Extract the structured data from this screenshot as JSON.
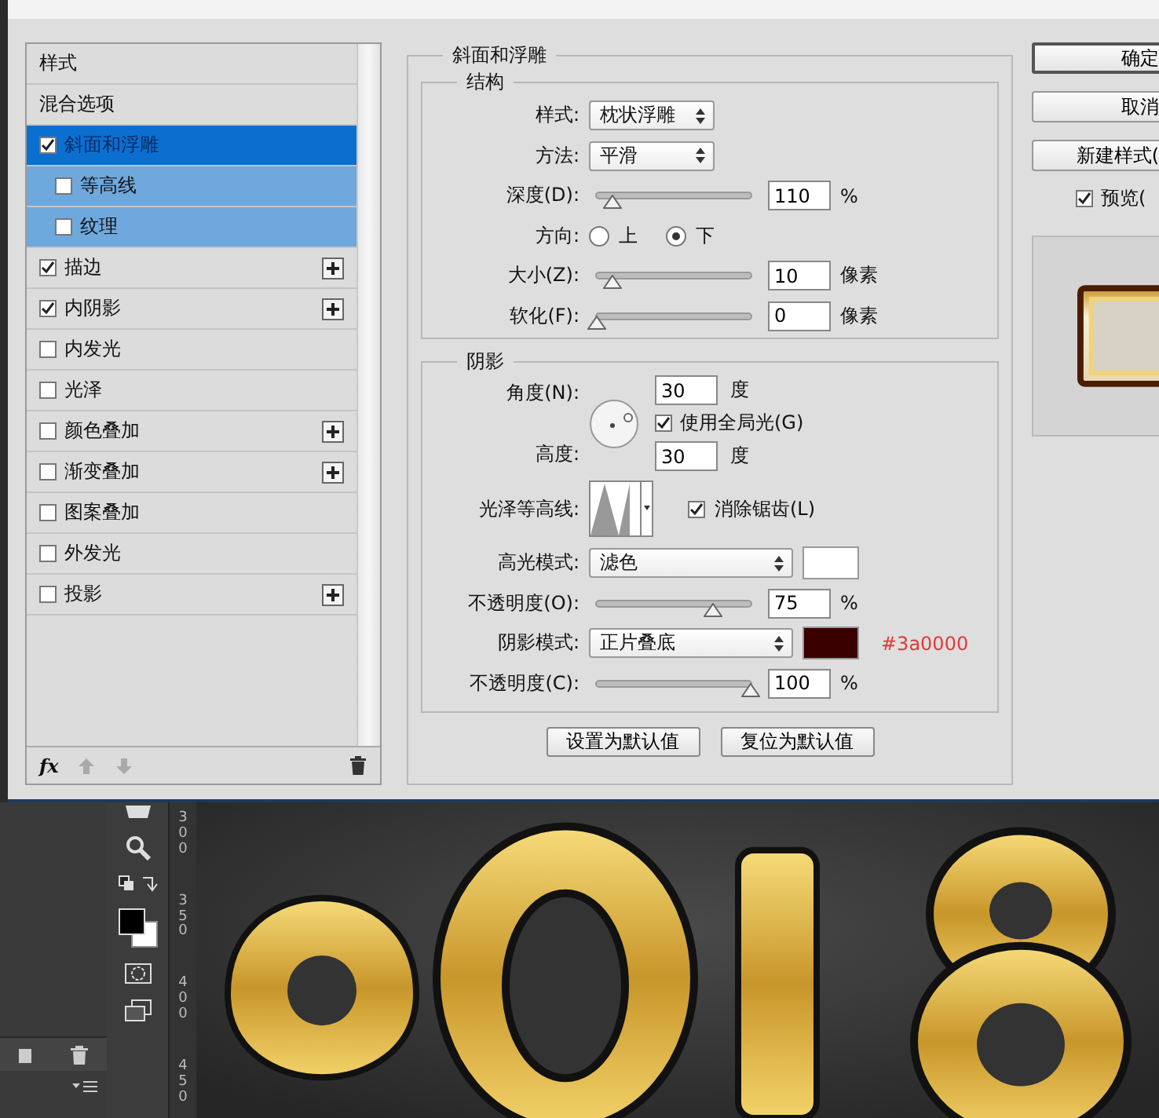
{
  "styles_list": {
    "items": [
      {
        "kind": "heading",
        "label": "样式"
      },
      {
        "kind": "heading",
        "label": "混合选项"
      },
      {
        "kind": "effect",
        "label": "斜面和浮雕",
        "checked": true,
        "selected": true,
        "children": [
          {
            "label": "等高线",
            "checked": false,
            "selected": false
          },
          {
            "label": "纹理",
            "checked": false,
            "selected": false
          }
        ]
      },
      {
        "kind": "effect",
        "label": "描边",
        "checked": true,
        "selected": false,
        "addable": true
      },
      {
        "kind": "effect",
        "label": "内阴影",
        "checked": true,
        "selected": false,
        "addable": true
      },
      {
        "kind": "effect",
        "label": "内发光",
        "checked": false,
        "selected": false,
        "addable": false
      },
      {
        "kind": "effect",
        "label": "光泽",
        "checked": false,
        "selected": false,
        "addable": false
      },
      {
        "kind": "effect",
        "label": "颜色叠加",
        "checked": false,
        "selected": false,
        "addable": true
      },
      {
        "kind": "effect",
        "label": "渐变叠加",
        "checked": false,
        "selected": false,
        "addable": true
      },
      {
        "kind": "effect",
        "label": "图案叠加",
        "checked": false,
        "selected": false,
        "addable": false
      },
      {
        "kind": "effect",
        "label": "外发光",
        "checked": false,
        "selected": false,
        "addable": false
      },
      {
        "kind": "effect",
        "label": "投影",
        "checked": false,
        "selected": false,
        "addable": true
      }
    ],
    "footer_fx": "fx"
  },
  "bevel": {
    "title": "斜面和浮雕",
    "structure": {
      "title": "结构",
      "rows": [
        {
          "kind": "select",
          "label": "样式:",
          "value": "枕状浮雕"
        },
        {
          "kind": "select",
          "label": "方法:",
          "value": "平滑"
        },
        {
          "kind": "slider",
          "label": "深度(D):",
          "level": 0.1,
          "value": "110",
          "unit": "%"
        },
        {
          "kind": "radio",
          "label": "方向:",
          "options": [
            {
              "label": "上",
              "selected": false
            },
            {
              "label": "下",
              "selected": true
            }
          ]
        },
        {
          "kind": "slider",
          "label": "大小(Z):",
          "level": 0.1,
          "value": "10",
          "unit": "像素"
        },
        {
          "kind": "slider",
          "label": "软化(F):",
          "level": 0,
          "value": "0",
          "unit": "像素"
        }
      ]
    },
    "shading": {
      "title": "阴影",
      "angle": {
        "label": "角度(N):",
        "value": "30",
        "unit": "度"
      },
      "global_light": {
        "label": "使用全局光(G)",
        "checked": true
      },
      "altitude": {
        "label": "高度:",
        "value": "30",
        "unit": "度"
      },
      "gloss_contour": {
        "label": "光泽等高线:"
      },
      "anti_alias": {
        "label": "消除锯齿(L)",
        "checked": true
      },
      "rows": [
        {
          "kind": "mode",
          "label": "高光模式:",
          "value": "滤色",
          "color": "#ffffff"
        },
        {
          "kind": "slider",
          "label": "不透明度(O):",
          "level": 0.75,
          "value": "75",
          "unit": "%"
        },
        {
          "kind": "mode",
          "label": "阴影模式:",
          "value": "正片叠底",
          "color": "#3a0000",
          "note": "#3a0000"
        },
        {
          "kind": "slider",
          "label": "不透明度(C):",
          "level": 1,
          "value": "100",
          "unit": "%"
        }
      ]
    },
    "buttons": [
      "设置为默认值",
      "复位为默认值"
    ]
  },
  "actions": [
    "确定",
    "取消",
    "新建样式("
  ],
  "preview": {
    "label": "预览(",
    "checked": true
  },
  "workspace": {
    "ruler": [
      "300",
      "350",
      "400",
      "450"
    ]
  }
}
